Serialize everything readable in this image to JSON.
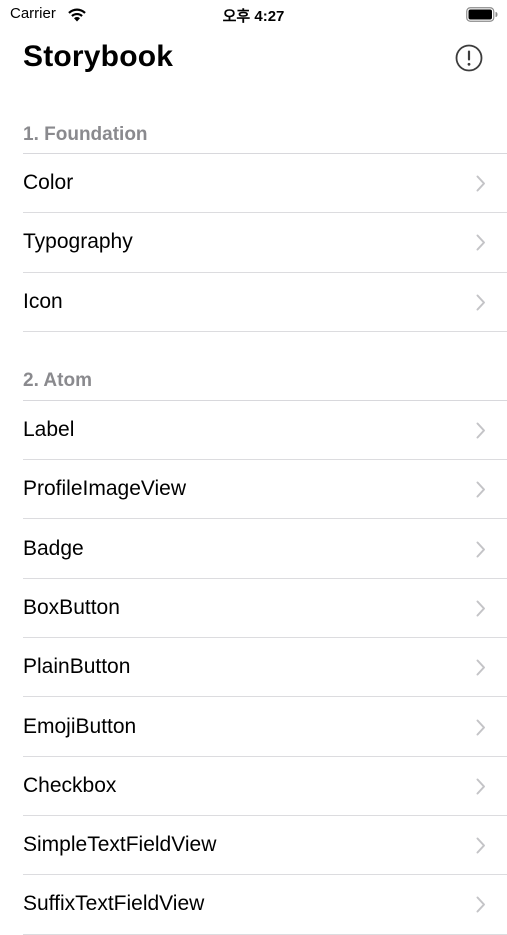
{
  "status_bar": {
    "carrier": "Carrier",
    "time": "오후 4:27"
  },
  "header": {
    "title": "Storybook",
    "info_icon": "exclamation-circle-icon"
  },
  "colors": {
    "section_header": "#8a8a8e",
    "separator": "#dcdcdf",
    "chevron": "#c4c4c7"
  },
  "sections": [
    {
      "title": "1. Foundation",
      "items": [
        {
          "label": "Color"
        },
        {
          "label": "Typography"
        },
        {
          "label": "Icon"
        }
      ]
    },
    {
      "title": "2. Atom",
      "items": [
        {
          "label": "Label"
        },
        {
          "label": "ProfileImageView"
        },
        {
          "label": "Badge"
        },
        {
          "label": "BoxButton"
        },
        {
          "label": "PlainButton"
        },
        {
          "label": "EmojiButton"
        },
        {
          "label": "Checkbox"
        },
        {
          "label": "SimpleTextFieldView"
        },
        {
          "label": "SuffixTextFieldView"
        }
      ]
    }
  ]
}
